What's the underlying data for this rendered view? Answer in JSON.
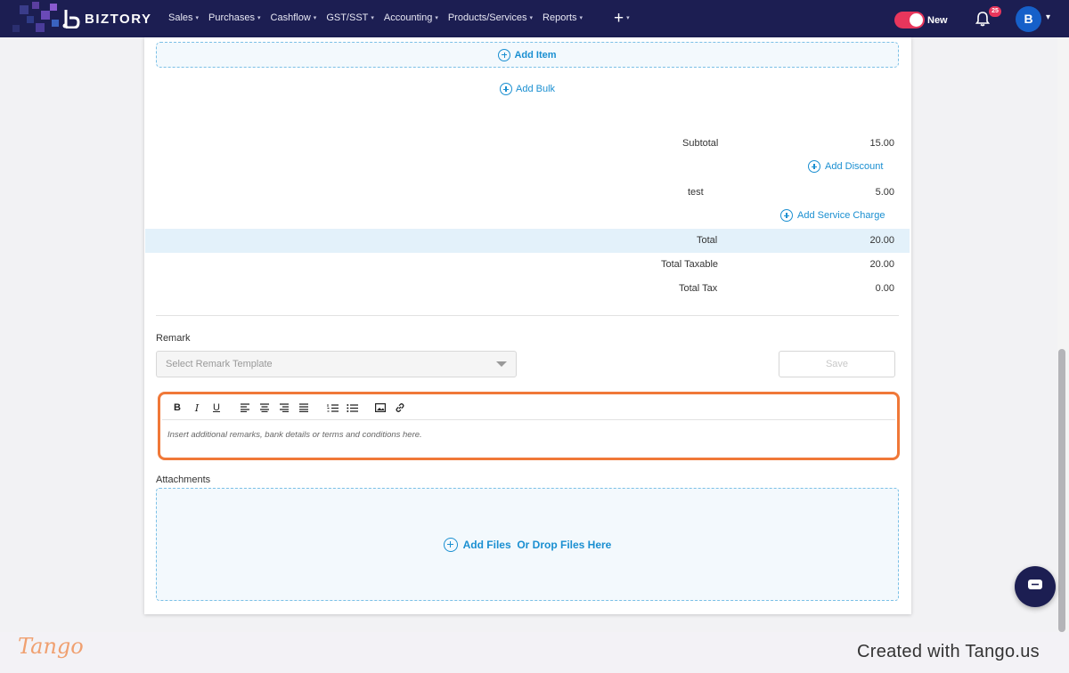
{
  "navbar": {
    "brand": "BIZTORY",
    "menu": [
      {
        "label": "Sales"
      },
      {
        "label": "Purchases"
      },
      {
        "label": "Cashflow"
      },
      {
        "label": "GST/SST"
      },
      {
        "label": "Accounting"
      },
      {
        "label": "Products/Services"
      },
      {
        "label": "Reports"
      }
    ],
    "toggle_label": "New",
    "notification_count": "25",
    "avatar_initial": "B",
    "colors": {
      "bar": "#1c1e52",
      "toggle": "#e8365c",
      "avatar": "#1660c9"
    }
  },
  "items": {
    "add_item_label": "Add Item",
    "add_bulk_label": "Add Bulk"
  },
  "summary": {
    "subtotal_label": "Subtotal",
    "subtotal_value": "15.00",
    "add_discount_label": "Add Discount",
    "charge_label": "test",
    "charge_value": "5.00",
    "add_service_charge_label": "Add Service Charge",
    "total_label": "Total",
    "total_value": "20.00",
    "total_taxable_label": "Total Taxable",
    "total_taxable_value": "20.00",
    "total_tax_label": "Total Tax",
    "total_tax_value": "0.00"
  },
  "remark": {
    "label": "Remark",
    "template_placeholder": "Select Remark Template",
    "save_label": "Save",
    "editor_placeholder": "Insert additional remarks, bank details or terms and conditions here.",
    "toolbar": [
      "bold-icon",
      "italic-icon",
      "underline-icon",
      "align-left-icon",
      "align-center-icon",
      "align-right-icon",
      "align-justify-icon",
      "ordered-list-icon",
      "bullet-list-icon",
      "image-icon",
      "link-icon"
    ]
  },
  "attachments": {
    "label": "Attachments",
    "add_files_label": "Add Files  Or Drop Files Here"
  },
  "footer": {
    "tango_logo": "Tango",
    "credit": "Created with Tango.us"
  },
  "colors": {
    "accent": "#1a8fd1",
    "highlight": "#f07838",
    "total_row": "#e3f1fa"
  }
}
